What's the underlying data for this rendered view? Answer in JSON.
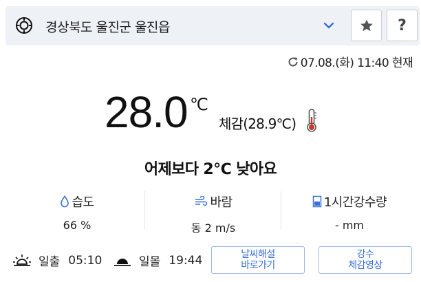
{
  "location": {
    "name": "경상북도 울진군 울진읍"
  },
  "updated": {
    "text": "07.08.(화) 11:40 현재"
  },
  "current": {
    "temperature": "28.0",
    "unit": "℃",
    "feels_like": "체감(28.9℃)",
    "comparison": "어제보다 2℃ 낮아요"
  },
  "stats": {
    "humidity": {
      "label": "습도",
      "value": "66 %"
    },
    "wind": {
      "label": "바람",
      "value": "동 2 m/s"
    },
    "rain": {
      "label": "1시간강수량",
      "value": "- mm"
    }
  },
  "sun": {
    "sunrise_label": "일출",
    "sunrise_time": "05:10",
    "sunset_label": "일몰",
    "sunset_time": "19:44"
  },
  "buttons": {
    "commentary_line1": "날씨해설",
    "commentary_line2": "바로가기",
    "rainvideo_line1": "강수",
    "rainvideo_line2": "체감영상"
  },
  "icons": {
    "location_target": "crosshair-icon",
    "dropdown": "chevron-down-icon",
    "favorite": "star-icon",
    "help": "question-icon",
    "refresh": "refresh-icon",
    "thermometer": "thermometer-icon",
    "humidity": "droplet-icon",
    "wind": "wind-icon",
    "rain": "rain-gauge-icon",
    "sunrise": "sunrise-icon",
    "sunset": "sunset-icon"
  },
  "colors": {
    "accent": "#3a6fd8",
    "thermo_red": "#c0392b",
    "bar_bg": "#eef1f6"
  },
  "help_glyph": "?"
}
